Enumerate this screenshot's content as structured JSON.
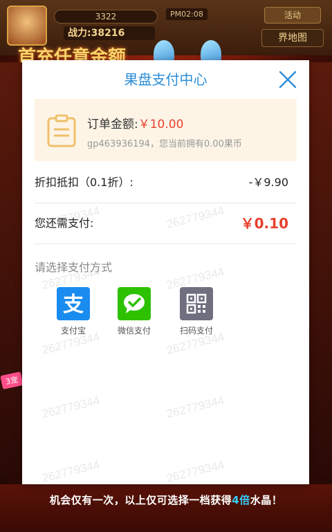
{
  "game": {
    "top_bar_value": "3322",
    "power_text": "战力:38216",
    "time_text": "PM02:08",
    "top_button": "活动",
    "map_button": "界地图",
    "banner": "首充任意金额",
    "side_tag": "3宠",
    "footer": {
      "part1": "机会仅有一次，以上仅可选择一档获得",
      "highlight": "4倍",
      "part2": "水晶！"
    }
  },
  "modal": {
    "title": "果盘支付中心",
    "order": {
      "label": "订单金额:",
      "price": "￥10.00",
      "sub": "gp463936194，您当前拥有0.00果币"
    },
    "discount": {
      "label": "折扣抵扣（0.1折）:",
      "value": "-￥9.90"
    },
    "remaining": {
      "label": "您还需支付:",
      "value": "￥0.10"
    },
    "pay_title": "请选择支付方式",
    "methods": [
      {
        "label": "支付宝",
        "icon": "alipay-icon",
        "color": "#1a8cf0"
      },
      {
        "label": "微信支付",
        "icon": "wechat-icon",
        "color": "#2dc100"
      },
      {
        "label": "扫码支付",
        "icon": "qrcode-icon",
        "color": "#6f6f80"
      }
    ],
    "watermark": "262779344"
  },
  "colors": {
    "title_blue": "#2d8ed8",
    "price_red": "#e8412e",
    "order_bg": "#fdf4e6"
  }
}
